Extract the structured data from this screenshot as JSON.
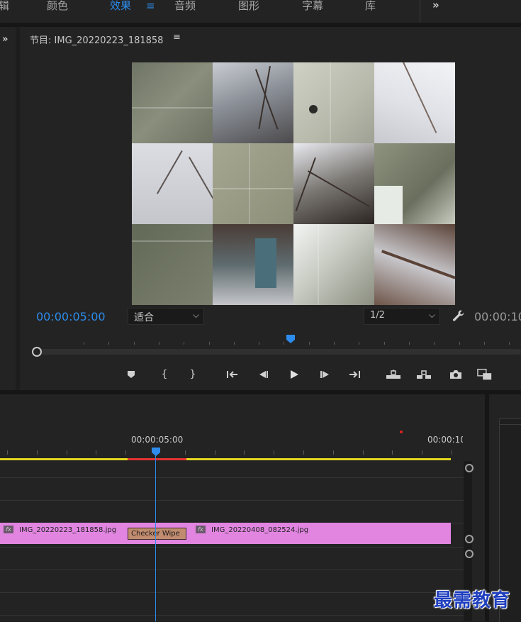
{
  "workspace": {
    "tabs": [
      {
        "label": "辑"
      },
      {
        "label": "颜色"
      },
      {
        "label": "效果"
      },
      {
        "label": "音频"
      },
      {
        "label": "图形"
      },
      {
        "label": "字幕"
      },
      {
        "label": "库"
      }
    ],
    "active_tab": "效果",
    "menu_icon": "hamburger-icon",
    "more_icon": "double-chevron-right-icon",
    "accent_color": "#2d8ceb"
  },
  "left_panel": {
    "expand_icon": "double-chevron-right-icon"
  },
  "program_monitor": {
    "title_prefix": "节目:",
    "sequence_name": "IMG_20220223_181858",
    "menu_icon": "hamburger-icon",
    "current_timecode": "00:00:05:00",
    "fit_value": "适合",
    "resolution_value": "1/2",
    "duration_timecode": "00:00:10",
    "settings_icon": "wrench-icon",
    "transport_buttons": [
      {
        "name": "add-marker-button",
        "icon": "marker-icon"
      },
      {
        "name": "mark-in-button",
        "icon": "mark-in-icon"
      },
      {
        "name": "mark-out-button",
        "icon": "mark-out-icon"
      },
      {
        "name": "go-to-in-button",
        "icon": "go-to-in-icon"
      },
      {
        "name": "step-back-button",
        "icon": "step-back-icon"
      },
      {
        "name": "play-button",
        "icon": "play-icon"
      },
      {
        "name": "step-forward-button",
        "icon": "step-forward-icon"
      },
      {
        "name": "go-to-out-button",
        "icon": "go-to-out-icon"
      },
      {
        "name": "lift-button",
        "icon": "lift-icon"
      },
      {
        "name": "extract-button",
        "icon": "extract-icon"
      },
      {
        "name": "export-frame-button",
        "icon": "camera-icon"
      },
      {
        "name": "comparison-view-button",
        "icon": "comparison-view-icon"
      }
    ]
  },
  "timeline": {
    "ruler_timecode_mid": "00:00:05:00",
    "ruler_timecode_end": "00:00:10",
    "clips": [
      {
        "name": "IMG_20220223_181858.jpg",
        "fx": "fx"
      },
      {
        "name": "IMG_20220408_082524.jpg",
        "fx": "fx"
      }
    ],
    "transition": "Checker Wipe",
    "clip_color": "#e185e1",
    "transition_color": "#c08b6f",
    "render_bar_color": "#e3d71d",
    "marker_color": "#e02020"
  },
  "watermark": "最需教育"
}
